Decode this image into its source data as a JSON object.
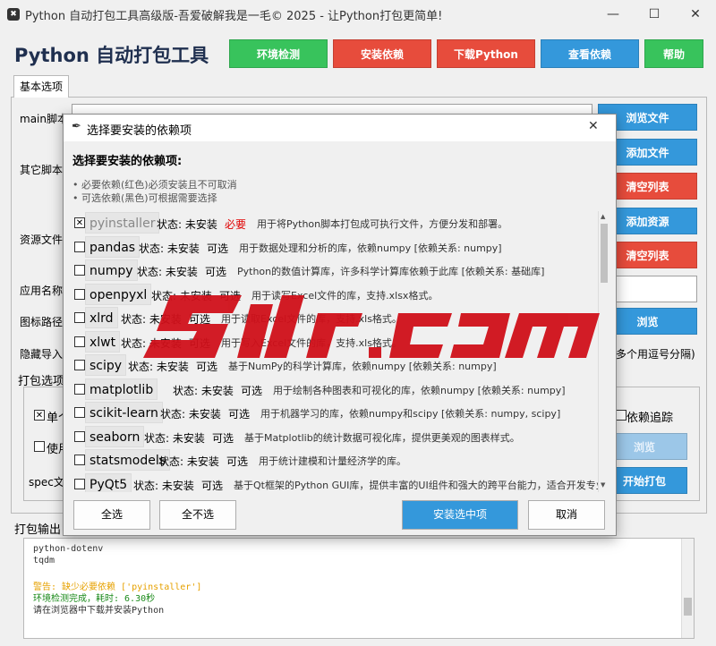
{
  "window": {
    "title": "Python 自动打包工具高级版-吾爱破解我是一毛© 2025 - 让Python打包更简单!",
    "minimize": "—",
    "maximize": "☐",
    "close": "✕"
  },
  "app": {
    "title": "Python 自动打包工具",
    "buttons": [
      {
        "label": "环境检测",
        "color": "#38c35c"
      },
      {
        "label": "安装依赖",
        "color": "#e74c3c"
      },
      {
        "label": "下载Python",
        "color": "#e74c3c"
      },
      {
        "label": "查看依赖",
        "color": "#3498db"
      },
      {
        "label": "帮助",
        "color": "#38c35c"
      }
    ]
  },
  "tabs": [
    "基本选项"
  ],
  "bg_labels": {
    "main_script": "main脚本",
    "other_scripts": "其它脚本",
    "resource_files": "资源文件",
    "app_name": "应用名称",
    "icon_path": "图标路径",
    "hidden_import": "隐藏导入",
    "hidden_hint": "多个用逗号分隔)",
    "pack_options": "打包选项",
    "single_file": "单个",
    "use": "使用",
    "dep_trace": "依赖追踪",
    "spec": "spec文",
    "output": "打包输出"
  },
  "side_buttons": [
    {
      "label": "浏览文件",
      "color": "#3498db"
    },
    {
      "label": "添加文件",
      "color": "#3498db"
    },
    {
      "label": "清空列表",
      "color": "#e74c3c"
    },
    {
      "label": "添加资源",
      "color": "#3498db"
    },
    {
      "label": "清空列表",
      "color": "#e74c3c"
    },
    {
      "label": "浏览",
      "color": "#3498db"
    },
    {
      "label": "浏览",
      "color": "#9cc7e8"
    },
    {
      "label": "开始打包",
      "color": "#3498db"
    }
  ],
  "output_lines": [
    {
      "text": "python-dotenv",
      "color": "#333333"
    },
    {
      "text": "tqdm",
      "color": "#333333"
    },
    {
      "text": "",
      "color": "#333333"
    },
    {
      "text": "警告: 缺少必要依赖 ['pyinstaller']",
      "color": "#e6a100"
    },
    {
      "text": "环境检测完成，耗时: 6.30秒",
      "color": "#1a8a1a"
    },
    {
      "text": "请在浏览器中下载并安装Python",
      "color": "#333333"
    }
  ],
  "dialog": {
    "title": "选择要安装的依赖项",
    "close": "✕",
    "heading": "选择要安装的依赖项:",
    "notes": [
      "• 必要依赖(红色)必须安装且不可取消",
      "• 可选依赖(黑色)可根据需要选择"
    ],
    "packages": [
      {
        "name": "pyinstaller",
        "status": "状态: 未安装",
        "type": "必要",
        "desc": "用于将Python脚本打包成可执行文件，方便分发和部署。",
        "checked": true,
        "required": true
      },
      {
        "name": "pandas",
        "status": "状态: 未安装",
        "type": "可选",
        "desc": "用于数据处理和分析的库，依赖numpy [依赖关系: numpy]",
        "checked": false,
        "required": false
      },
      {
        "name": "numpy",
        "status": "状态: 未安装",
        "type": "可选",
        "desc": "Python的数值计算库，许多科学计算库依赖于此库 [依赖关系: 基础库]",
        "checked": false,
        "required": false
      },
      {
        "name": "openpyxl",
        "status": "状态: 未安装",
        "type": "可选",
        "desc": "用于读写Excel文件的库，支持.xlsx格式。",
        "checked": false,
        "required": false
      },
      {
        "name": "xlrd",
        "status": "状态: 未安装",
        "type": "可选",
        "desc": "用于读取Excel文件的库，支持.xls格式。",
        "checked": false,
        "required": false
      },
      {
        "name": "xlwt",
        "status": "状态: 未安装",
        "type": "可选",
        "desc": "用于写入Excel文件的库，支持.xls格式。",
        "checked": false,
        "required": false
      },
      {
        "name": "scipy",
        "status": "状态: 未安装",
        "type": "可选",
        "desc": "基于NumPy的科学计算库，依赖numpy [依赖关系: numpy]",
        "checked": false,
        "required": false
      },
      {
        "name": "matplotlib",
        "status": "状态: 未安装",
        "type": "可选",
        "desc": "用于绘制各种图表和可视化的库，依赖numpy [依赖关系: numpy]",
        "checked": false,
        "required": false
      },
      {
        "name": "scikit-learn",
        "status": "状态: 未安装",
        "type": "可选",
        "desc": "用于机器学习的库，依赖numpy和scipy [依赖关系: numpy, scipy]",
        "checked": false,
        "required": false
      },
      {
        "name": "seaborn",
        "status": "状态: 未安装",
        "type": "可选",
        "desc": "基于Matplotlib的统计数据可视化库，提供更美观的图表样式。",
        "checked": false,
        "required": false
      },
      {
        "name": "statsmodels",
        "status": "状态: 未安装",
        "type": "可选",
        "desc": "用于统计建模和计量经济学的库。",
        "checked": false,
        "required": false
      },
      {
        "name": "PyQt5",
        "status": "状态: 未安装",
        "type": "可选",
        "desc": "基于Qt框架的Python GUI库，提供丰富的UI组件和强大的跨平台能力，适合开发专业级",
        "checked": false,
        "required": false
      }
    ],
    "buttons": {
      "select_all": "全选",
      "select_none": "全不选",
      "install": "安装选中项",
      "cancel": "取消"
    }
  },
  "colors": {
    "required": "#e00000",
    "install_button": "#3498db",
    "watermark": "#d0101a"
  }
}
